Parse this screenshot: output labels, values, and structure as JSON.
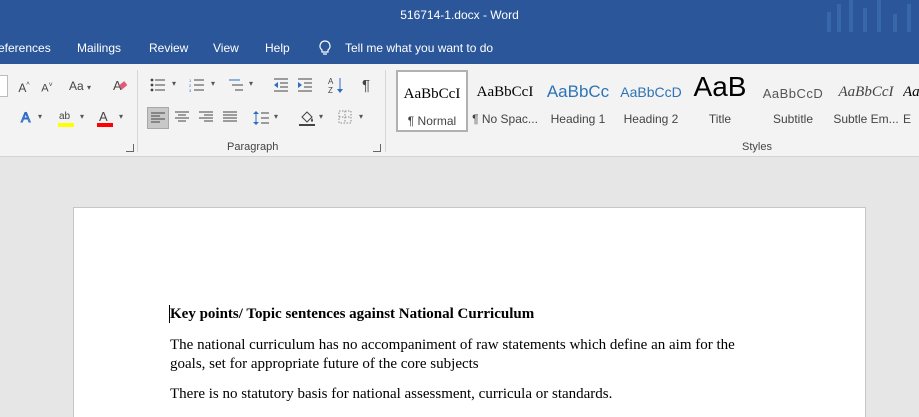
{
  "window": {
    "title": "516714-1.docx  -  Word"
  },
  "menu": {
    "tabs": [
      "eferences",
      "Mailings",
      "Review",
      "View",
      "Help"
    ],
    "tell_me": "Tell me what you want to do"
  },
  "ribbon": {
    "font_case_label": "Aa",
    "paragraph_label": "Paragraph",
    "styles_label": "Styles",
    "pilcrow": "¶",
    "styles": [
      {
        "preview": "AaBbCcI",
        "name": "¶ Normal"
      },
      {
        "preview": "AaBbCcI",
        "name": "¶ No Spac..."
      },
      {
        "preview": "AaBbCc",
        "name": "Heading 1"
      },
      {
        "preview": "AaBbCcD",
        "name": "Heading 2"
      },
      {
        "preview": "AaB",
        "name": "Title"
      },
      {
        "preview": "AaBbCcD",
        "name": "Subtitle"
      },
      {
        "preview": "AaBbCcI",
        "name": "Subtle Em..."
      },
      {
        "preview": "Aa",
        "name": "E"
      }
    ],
    "colors": {
      "highlight": "#ffff00",
      "font_color": "#ff0000",
      "brand": "#2b579a"
    }
  },
  "document": {
    "heading": "Key points/ Topic sentences against National Curriculum",
    "paragraphs": [
      "The national curriculum has no accompaniment of raw statements which define an aim for the goals, set for appropriate future of the core subjects",
      "There is no statutory basis for national assessment, curricula or standards."
    ]
  }
}
